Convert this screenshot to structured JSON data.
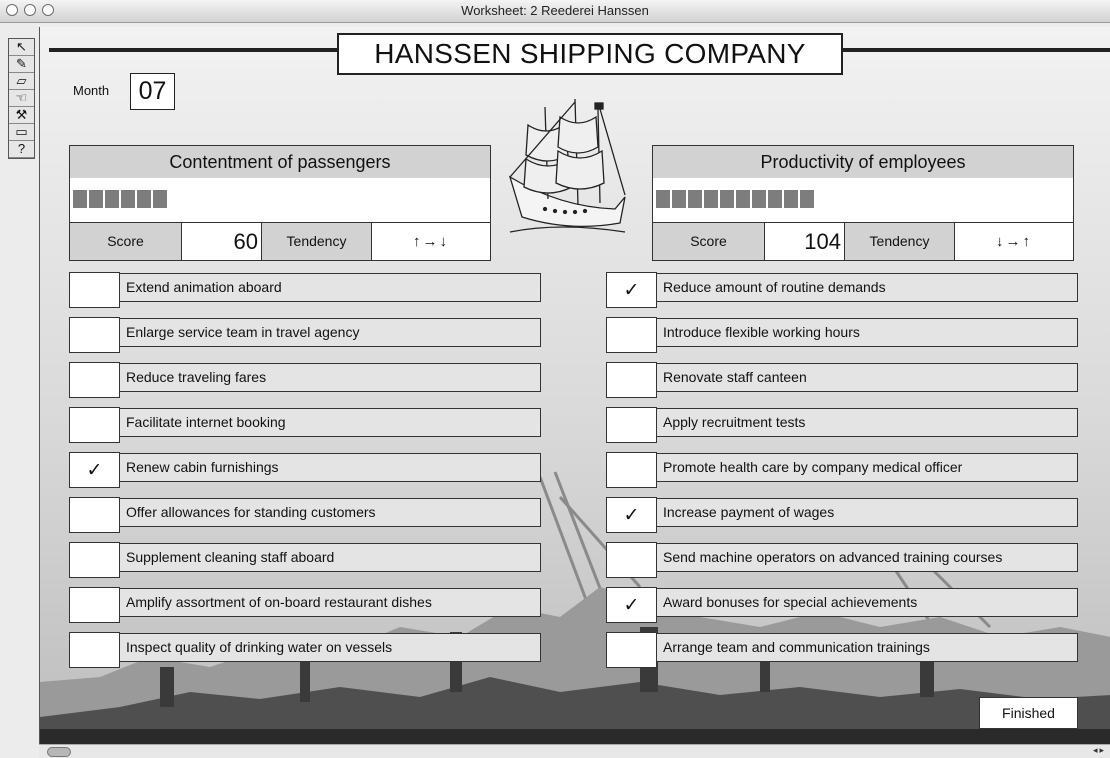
{
  "window": {
    "title": "Worksheet: 2 Reederei Hanssen"
  },
  "toolbox": {
    "tools": [
      {
        "name": "browse-tool-icon",
        "glyph": "↖"
      },
      {
        "name": "pencil-tool-icon",
        "glyph": "✎"
      },
      {
        "name": "eraser-tool-icon",
        "glyph": "▱"
      },
      {
        "name": "hand-tool-icon",
        "glyph": "☜"
      },
      {
        "name": "hammer-tool-icon",
        "glyph": "⚒"
      },
      {
        "name": "field-tool-icon",
        "glyph": "▭"
      },
      {
        "name": "help-tool-icon",
        "glyph": "?"
      }
    ]
  },
  "header": {
    "title": "HANSSEN SHIPPING COMPANY",
    "month_label": "Month",
    "month_value": "07"
  },
  "passengers": {
    "title": "Contentment of passengers",
    "bar_segments": 6,
    "score_label": "Score",
    "score": "60",
    "tendency_label": "Tendency",
    "tendency": "↑→↓"
  },
  "employees": {
    "title": "Productivity of employees",
    "bar_segments": 10,
    "score_label": "Score",
    "score": "104",
    "tendency_label": "Tendency",
    "tendency": "↓→↑"
  },
  "passenger_measures": [
    {
      "label": "Extend animation aboard",
      "mark": ""
    },
    {
      "label": "Enlarge service team in travel agency",
      "mark": ""
    },
    {
      "label": "Reduce traveling fares",
      "mark": ""
    },
    {
      "label": "Facilitate internet booking",
      "mark": ""
    },
    {
      "label": "Renew cabin furnishings",
      "mark": "✓"
    },
    {
      "label": "Offer allowances for standing customers",
      "mark": ""
    },
    {
      "label": "Supplement cleaning staff aboard",
      "mark": ""
    },
    {
      "label": "Amplify assortment of on-board restaurant dishes",
      "mark": ""
    },
    {
      "label": "Inspect quality of drinking water on vessels",
      "mark": ""
    }
  ],
  "employee_measures": [
    {
      "label": "Reduce amount of routine demands",
      "mark": "✓"
    },
    {
      "label": "Introduce flexible working hours",
      "mark": ""
    },
    {
      "label": "Renovate staff canteen",
      "mark": ""
    },
    {
      "label": "Apply recruitment tests",
      "mark": ""
    },
    {
      "label": "Promote health care by company medical officer",
      "mark": ""
    },
    {
      "label": "Increase payment of wages",
      "mark": "✓"
    },
    {
      "label": "Send machine operators on advanced training courses",
      "mark": ""
    },
    {
      "label": "Award bonuses for special achievements",
      "mark": "✓"
    },
    {
      "label": "Arrange team and communication trainings",
      "mark": ""
    }
  ],
  "footer": {
    "finished_label": "Finished"
  }
}
